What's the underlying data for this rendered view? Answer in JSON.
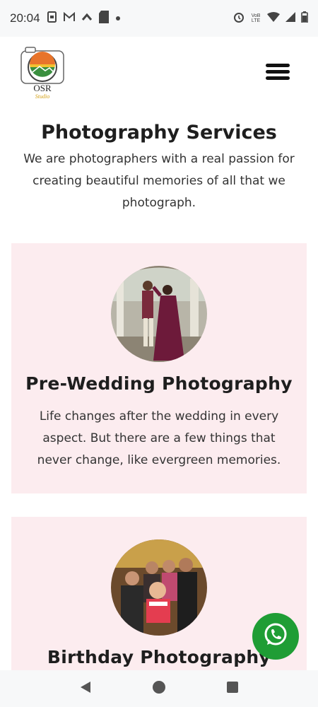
{
  "status_bar": {
    "time": "20:04",
    "left_icons": [
      "screenshot-icon",
      "gmail-icon",
      "chevron-up-icon",
      "sim-card-icon",
      "dot-icon"
    ],
    "volte_line1": "VoB",
    "volte_line2": "LTE",
    "right_icons": [
      "alarm-icon",
      "volte-icon",
      "wifi-icon",
      "signal-icon",
      "battery-icon"
    ]
  },
  "header": {
    "logo_text": "OSR",
    "logo_subtext": "Studio",
    "menu_icon": "hamburger-menu-icon"
  },
  "intro": {
    "title": "Photography Services",
    "text": "We are photographers with a real passion for creating beautiful memories of all that we photograph."
  },
  "services": [
    {
      "title": "Pre-Wedding Photography",
      "text": "Life changes after the wedding in every aspect. But there are a few things that never change, like evergreen memories."
    },
    {
      "title": "Birthday Photography"
    }
  ],
  "floating": {
    "whatsapp_icon": "whatsapp-icon"
  },
  "nav_bar": {
    "icons": [
      "back-icon",
      "home-icon",
      "recents-icon"
    ]
  },
  "colors": {
    "card_bg": "#fcecef",
    "whatsapp_green": "#1f9d35",
    "status_bg": "#f7f8f9"
  }
}
